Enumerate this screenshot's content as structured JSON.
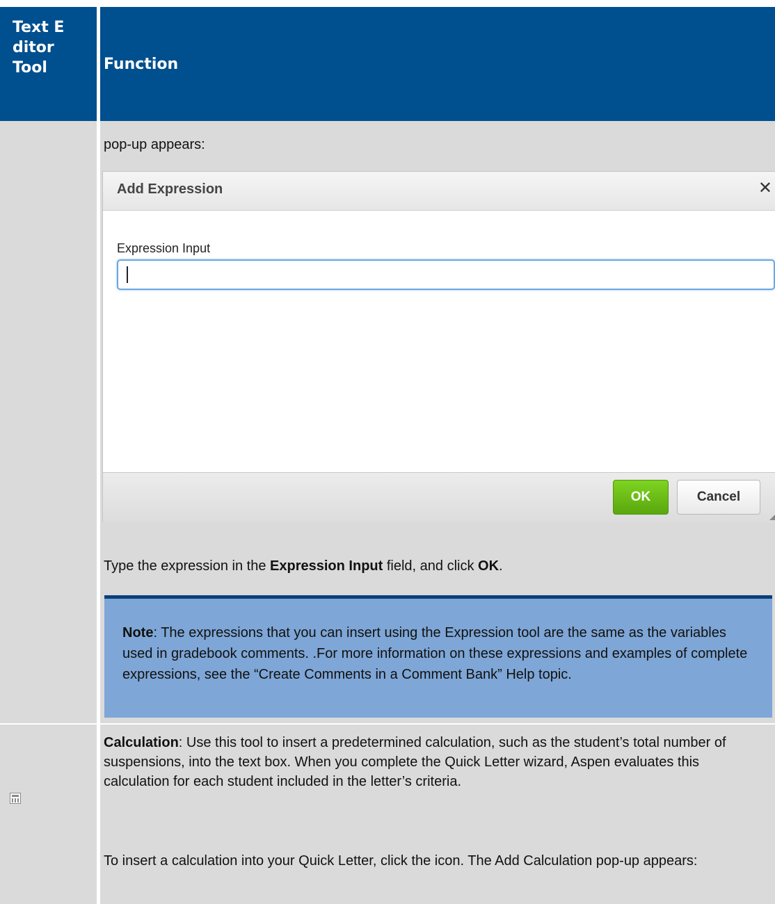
{
  "header": {
    "col1": "Text Editor Tool",
    "col2": "Function"
  },
  "row1": {
    "intro": "pop-up appears:",
    "dialog": {
      "title": "Add Expression",
      "close_glyph": "✕",
      "field_label": "Expression Input",
      "field_value": "",
      "ok_label": "OK",
      "cancel_label": "Cancel"
    },
    "instruction": {
      "part1": "Type the expression in the ",
      "bold1": "Expression Input",
      "part2": " field, and click ",
      "bold2": "OK",
      "part3": "."
    },
    "note": {
      "label": "Note",
      "text": ": The expressions that you can insert using the Expression tool are the same as the variables used in gradebook comments. .For more information on these expressions and examples of complete expressions, see the “Create Comments in a Comment Bank” Help topic."
    }
  },
  "row2": {
    "icon": "calculator-icon",
    "para1_bold": "Calculation",
    "para1": ": Use this tool to insert a predetermined calculation, such as the student’s total number of suspensions, into the text box. When you complete the Quick Letter wizard, Aspen evaluates this calculation for each student included in the letter’s criteria.",
    "para2": "To insert a calculation into your Quick Letter, click the icon. The Add Calculation pop-up appears:"
  },
  "colors": {
    "header_bg": "#004f8f",
    "row_bg": "#dadada",
    "note_bg": "#7ea6d6",
    "note_border": "#0b3f7a",
    "ok_green": "#6bbf18"
  }
}
